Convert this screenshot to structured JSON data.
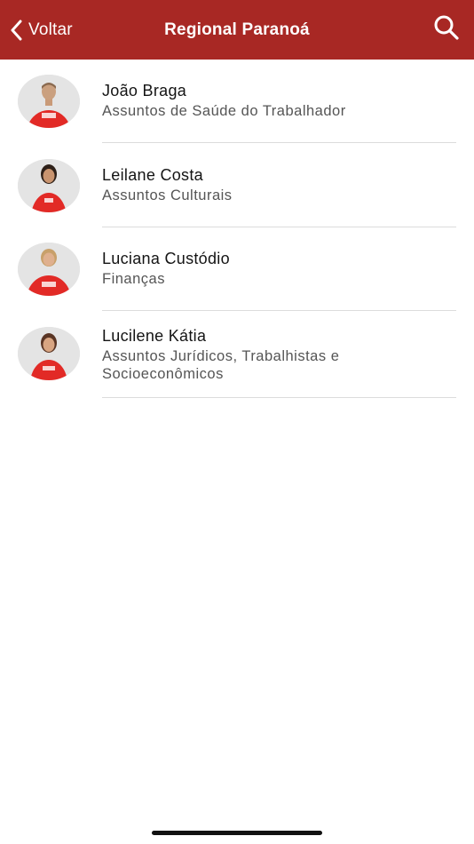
{
  "navbar": {
    "back_label": "Voltar",
    "title": "Regional Paranoá",
    "background_color": "#a82824",
    "back_icon": "chevron-left-icon",
    "search_icon": "search-icon"
  },
  "members": [
    {
      "name": "João Braga",
      "role": "Assuntos de Saúde do Trabalhador"
    },
    {
      "name": "Leilane Costa",
      "role": "Assuntos Culturais"
    },
    {
      "name": "Luciana Custódio",
      "role": "Finanças"
    },
    {
      "name": "Lucilene Kátia",
      "role": "Assuntos Jurídicos, Trabalhistas e Socioeconômicos"
    }
  ]
}
